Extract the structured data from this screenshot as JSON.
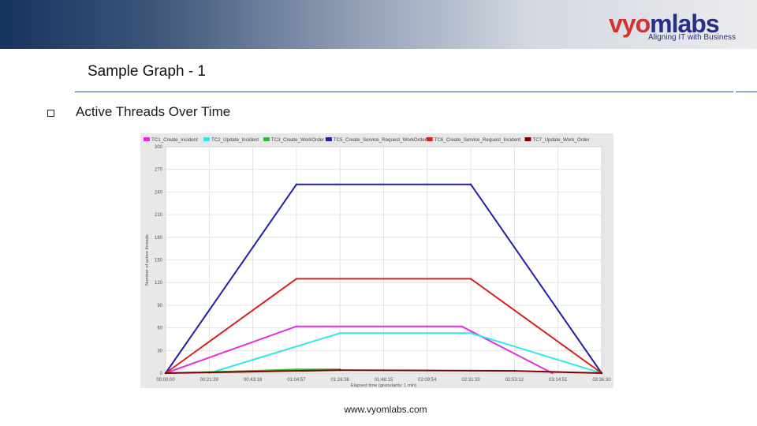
{
  "header": {
    "logo_text_1": "vy",
    "logo_text_2": "o",
    "logo_text_3": "mlabs",
    "logo_tagline": "Aligning IT with Business"
  },
  "slide": {
    "title": "Sample Graph - 1",
    "bullet_text": "Active Threads Over Time",
    "footer_url": "www.vyomlabs.com"
  },
  "colors": {
    "logo_red": "#d3322d",
    "logo_blue": "#2a2f86"
  },
  "chart_data": {
    "type": "line",
    "ylabel": "Number of active threads",
    "xlabel": "Elapsed time (granularity: 1 min)",
    "ylim": [
      0,
      300
    ],
    "yticks": [
      0,
      30,
      60,
      90,
      120,
      150,
      180,
      210,
      240,
      270,
      300
    ],
    "xticks": [
      "00:00:00",
      "00:21:39",
      "00:43:18",
      "01:04:57",
      "01:26:36",
      "01:48:15",
      "02:09:54",
      "02:31:33",
      "02:53:12",
      "03:14:51",
      "03:36:30"
    ],
    "grid": true,
    "legend_position": "top",
    "series": [
      {
        "name": "TC1_Create_Incident",
        "color": "#e030e0",
        "x": [
          "00:00:00",
          "01:04:57",
          "02:09:54",
          "02:27:00",
          "03:12:00"
        ],
        "values": [
          0,
          62,
          62,
          62,
          0
        ]
      },
      {
        "name": "TC2_Update_Incident",
        "color": "#30e8e8",
        "x": [
          "00:21:39",
          "01:26:36",
          "02:31:33",
          "03:36:30"
        ],
        "values": [
          0,
          53,
          53,
          0
        ]
      },
      {
        "name": "TC3_Create_WorkOrder",
        "color": "#30c030",
        "x": [
          "00:00:00",
          "00:43:18",
          "01:04:57",
          "01:26:36"
        ],
        "values": [
          0,
          3,
          5,
          5
        ]
      },
      {
        "name": "TC5_Create_Service_Request_WorkOrder",
        "color": "#2020a8",
        "x": [
          "00:00:00",
          "01:04:57",
          "02:31:33",
          "03:36:30"
        ],
        "values": [
          0,
          250,
          250,
          0
        ]
      },
      {
        "name": "TC6_Create_Service_Request_Incident",
        "color": "#d82020",
        "x": [
          "00:00:00",
          "01:04:57",
          "02:31:33",
          "03:36:30"
        ],
        "values": [
          0,
          125,
          125,
          0
        ]
      },
      {
        "name": "TC7_Update_Work_Order",
        "color": "#800000",
        "x": [
          "00:00:00",
          "01:26:36",
          "02:53:12",
          "03:36:30"
        ],
        "values": [
          0,
          4,
          3,
          0
        ]
      }
    ]
  }
}
